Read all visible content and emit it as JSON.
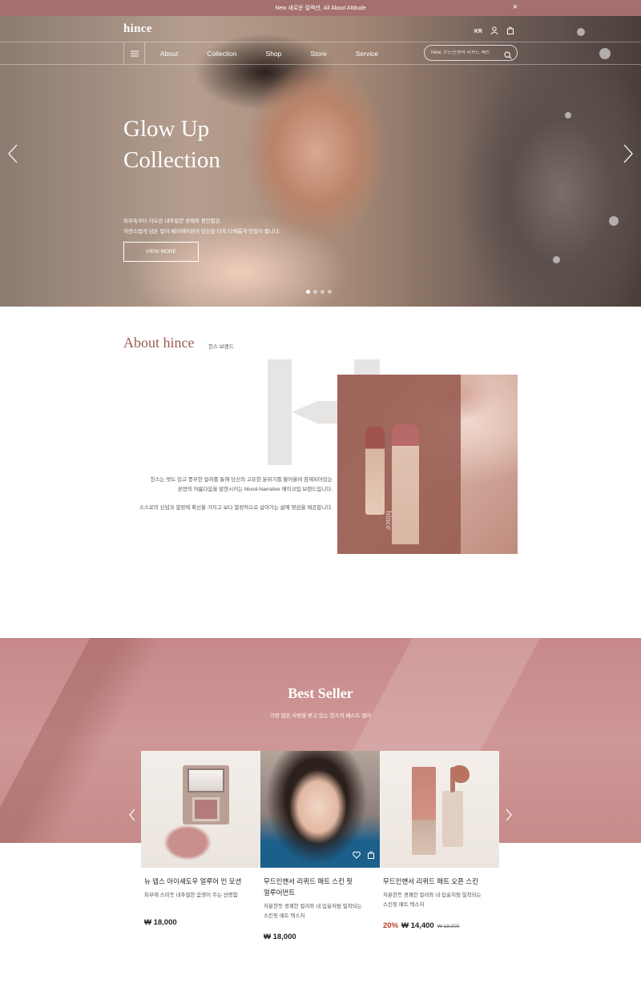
{
  "announcement": {
    "text": "New 새로운 컬렉션, All About Attitude",
    "close": "×"
  },
  "header": {
    "logo": "hince",
    "lang": "KR",
    "nav": [
      "About",
      "Collection",
      "Shop",
      "Store",
      "Service"
    ],
    "search_placeholder": "New, 무드인핸서 리퀴드 매트"
  },
  "hero": {
    "title_line1": "Glow Up",
    "title_line2": "Collection",
    "desc_line1": "피부속부터 차오른 내추럴한 광채와 편안함은,",
    "desc_line2": "자연스럽게 담은 컬러 베리에이션이 당신을 더욱 다채롭게 만들어 줍니다.",
    "button": "VIEW MORE",
    "slides": 4,
    "active_slide": 1
  },
  "about": {
    "title": "About hince",
    "subtitle": "힌스 브랜드",
    "para1_line1": "힌스는 멋도 있고 풍부한 컬러를 통해 당신의 고유한 분위기를 불어올려 참재되어있는",
    "para1_line2": "본연의 아름다움을 발현시키는 Mood-Narrative 메이크업 브랜드입니다.",
    "para2": "스스로의 신념과 열정에 확신을 가지고 보다 열정적으로 살아가는 삶에 영감을 제공합니다.",
    "image_brand": "hince"
  },
  "best_seller": {
    "title": "Best Seller",
    "subtitle": "가장 많은 사랑을 받고 있는 힌스의 베스트 셀러",
    "products": [
      {
        "name": "뉴 뎁스 아이섀도우 얼루어 인 모션",
        "desc_line1": "피부에 스미듯 내추럴한 음영이 주는 선명함",
        "desc_line2": "",
        "price": "₩ 18,000"
      },
      {
        "name_line1": "무드인핸서 리퀴드 매트 스킨 핏",
        "name_line2": "얼루어먼트",
        "desc_line1": "차분한듯 경쾌한 컬러와 내 입술처럼 밀착되는",
        "desc_line2": "스킨핏 매트 텍스처",
        "price": "₩ 18,000"
      },
      {
        "name": "무드인핸서 리퀴드 매트 오픈 스킨",
        "desc_line1": "차분한듯 경쾌한 컬러와 내 입술처럼 밀착되는",
        "desc_line2": "스킨핏 매트 텍스처",
        "discount": "20%",
        "price": "₩ 14,400",
        "original": "₩ 18,000"
      }
    ]
  },
  "colors": {
    "accent": "#a4706f",
    "about_title": "#9e5a4e",
    "best_bg": "#cf9797",
    "discount": "#c0392b"
  }
}
